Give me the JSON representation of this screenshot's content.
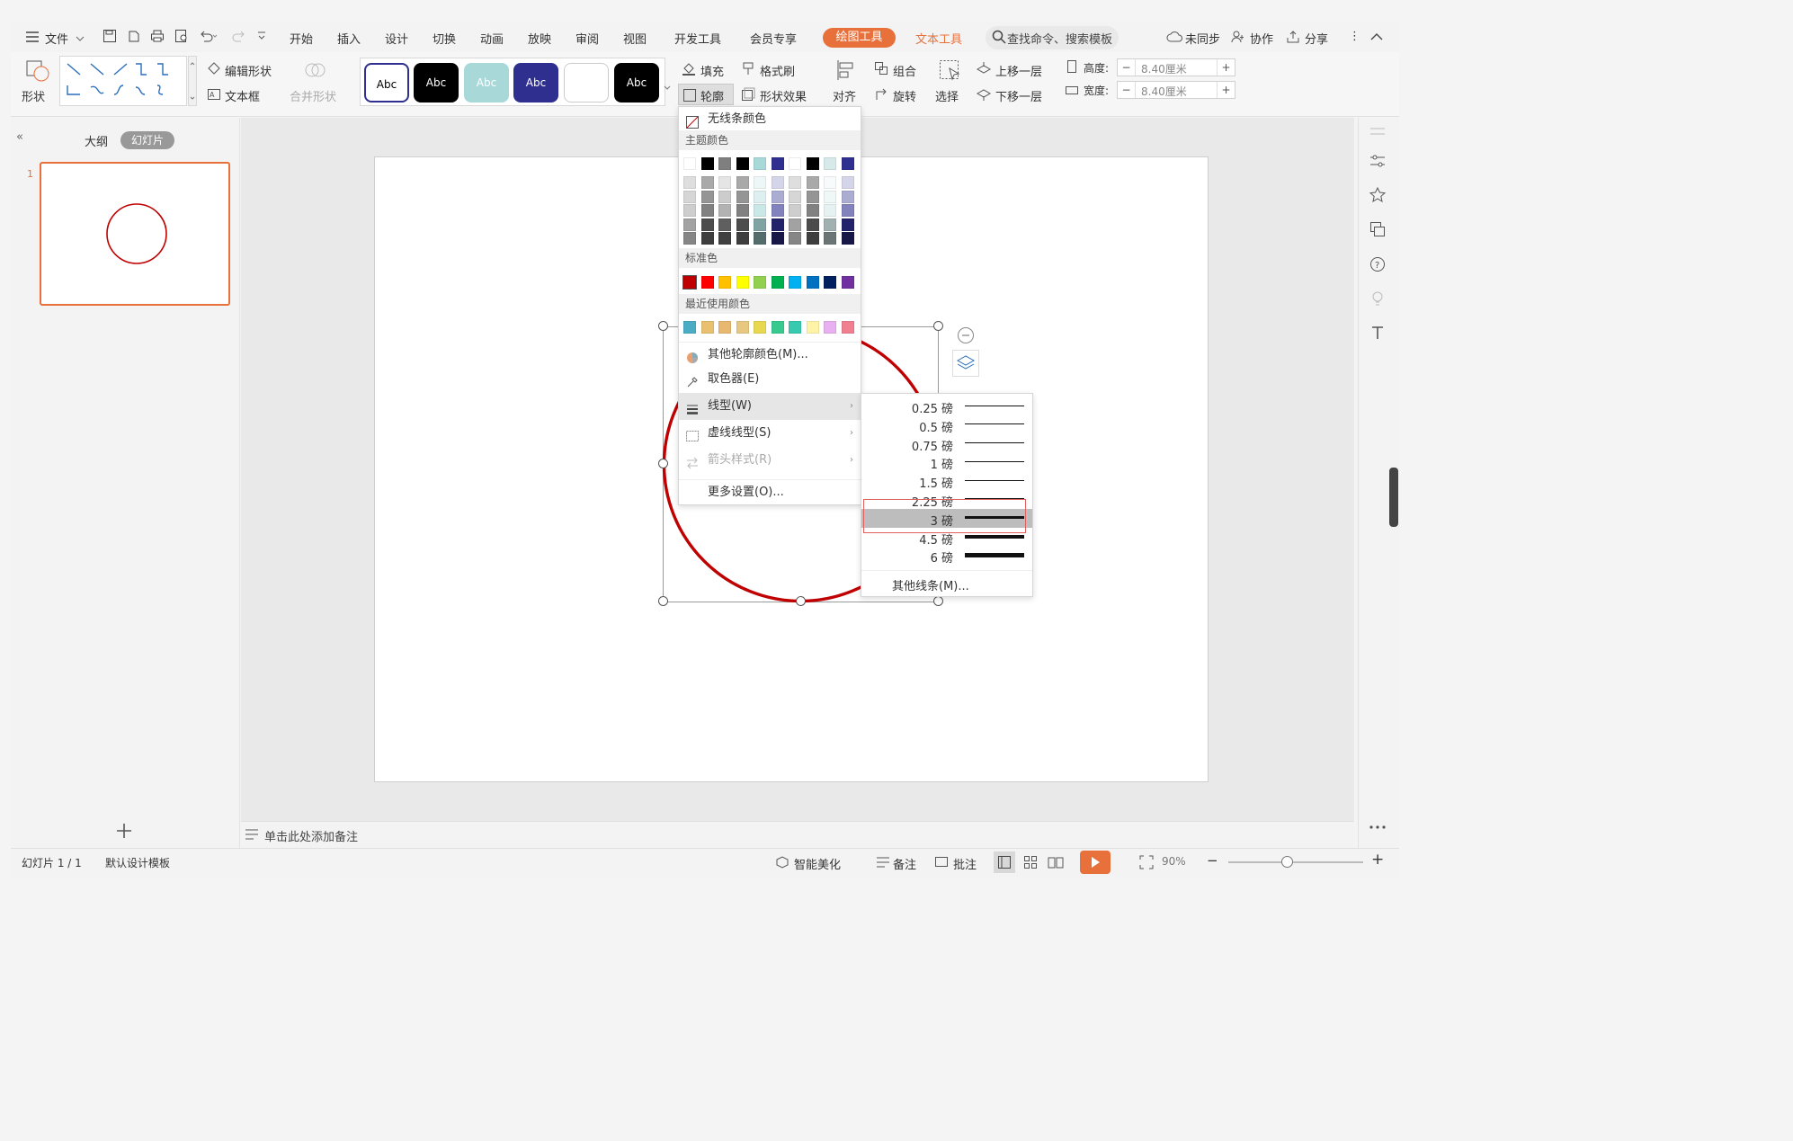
{
  "menu": {
    "file": "文件",
    "tabs": [
      "开始",
      "插入",
      "设计",
      "切换",
      "动画",
      "放映",
      "审阅",
      "视图",
      "开发工具",
      "会员专享"
    ],
    "active_tab": "绘图工具",
    "text_tool_tab": "文本工具",
    "search_placeholder": "查找命令、搜索模板",
    "sync": "未同步",
    "collab": "协作",
    "share": "分享"
  },
  "ribbon": {
    "shape": "形状",
    "edit_shape": "编辑形状",
    "textbox": "文本框",
    "merge_shape": "合并形状",
    "style_sample": "Abc",
    "fill": "填充",
    "format_painter": "格式刷",
    "outline": "轮廓",
    "shape_effect": "形状效果",
    "align": "对齐",
    "group": "组合",
    "rotate": "旋转",
    "select": "选择",
    "bring_forward": "上移一层",
    "send_backward": "下移一层",
    "height_label": "高度:",
    "height_value": "8.40厘米",
    "width_label": "宽度:",
    "width_value": "8.40厘米"
  },
  "left_panel": {
    "outline_tab": "大纲",
    "slides_tab": "幻灯片",
    "slide_number": "1"
  },
  "outline_menu": {
    "no_line_color": "无线条颜色",
    "theme_colors_title": "主题颜色",
    "standard_colors_title": "标准色",
    "recent_colors_title": "最近使用颜色",
    "theme_top_row": [
      "#ffffff",
      "#000000",
      "#7f7f7f",
      "#000000",
      "#a9d8d9",
      "#2e2f8f",
      "#ffffff",
      "#000000",
      "#d6eaea",
      "#2e2f8f"
    ],
    "standard_colors": [
      "#c00000",
      "#ff0000",
      "#ffc000",
      "#ffff00",
      "#92d050",
      "#00b050",
      "#00b0f0",
      "#0070c0",
      "#002060",
      "#7030a0"
    ],
    "recent_colors": [
      "#4bacc6",
      "#e8c170",
      "#e8b870",
      "#e8c880",
      "#e8d850",
      "#38c98e",
      "#38c9b0",
      "#fff3a8",
      "#e8b0f0",
      "#f08090"
    ],
    "more_outline_colors": "其他轮廓颜色(M)...",
    "eyedropper": "取色器(E)",
    "line_style": "线型(W)",
    "dash_style": "虚线线型(S)",
    "arrow_style": "箭头样式(R)",
    "more_settings": "更多设置(O)..."
  },
  "line_weights": {
    "options": [
      "0.25 磅",
      "0.5 磅",
      "0.75 磅",
      "1 磅",
      "1.5 磅",
      "2.25 磅",
      "3 磅",
      "4.5 磅",
      "6 磅"
    ],
    "weights_pt": [
      0.25,
      0.5,
      0.75,
      1,
      1.5,
      2.25,
      3,
      4.5,
      6
    ],
    "selected": "3 磅",
    "more_lines": "其他线条(M)..."
  },
  "notes": {
    "placeholder": "单击此处添加备注"
  },
  "status": {
    "slide_info": "幻灯片 1 / 1",
    "template": "默认设计模板",
    "beautify": "智能美化",
    "notes": "备注",
    "comments": "批注",
    "zoom": "90%"
  },
  "colors": {
    "accent": "#e8703a",
    "circle_stroke": "#c00000"
  }
}
